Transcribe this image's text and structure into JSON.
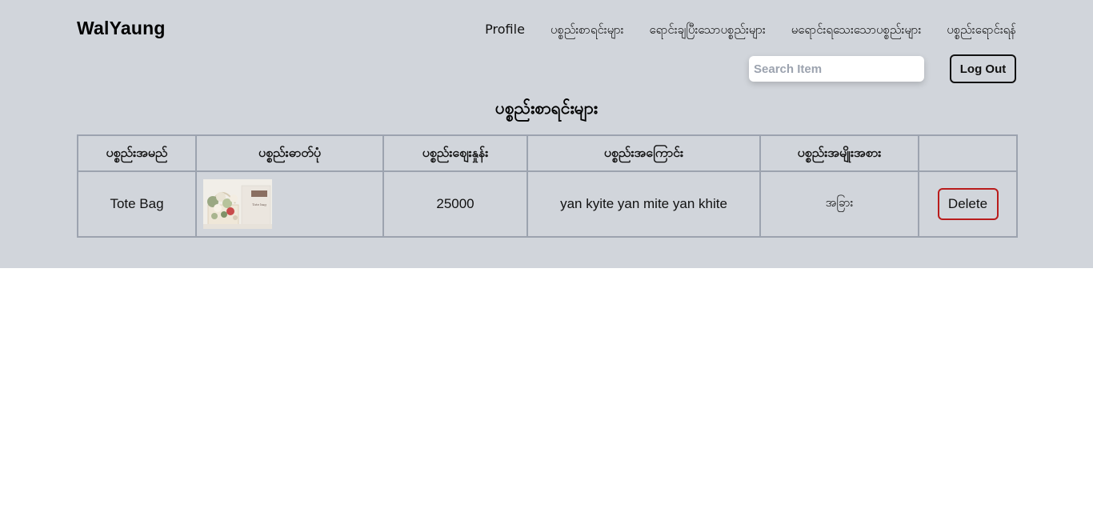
{
  "header": {
    "brand": "WalYaung",
    "nav": [
      "Profile",
      "ပစ္စည်းစာရင်းများ",
      "ရောင်းချပြီးသောပစ္စည်းများ",
      "မရောင်းရသေးသောပစ္စည်းများ",
      "ပစ္စည်းရောင်းရန်"
    ],
    "search_placeholder": "Search Item",
    "logout_label": "Log Out"
  },
  "main": {
    "title": "ပစ္စည်းစာရင်းများ",
    "table": {
      "headers": [
        "ပစ္စည်းအမည်",
        "ပစ္စည်းဓာတ်ပုံ",
        "ပစ္စည်းစျေးနှုန်း",
        "ပစ္စည်းအကြောင်း",
        "ပစ္စည်းအမျိုးအစား",
        ""
      ],
      "rows": [
        {
          "name": "Tote Bag",
          "photo_text": "Tote bag",
          "price": "25000",
          "description": "yan kyite yan mite yan khite",
          "type": "အခြား",
          "action": "Delete"
        }
      ]
    }
  },
  "colors": {
    "header_bg": "#d1d5db",
    "delete_border": "#b91c1c"
  }
}
